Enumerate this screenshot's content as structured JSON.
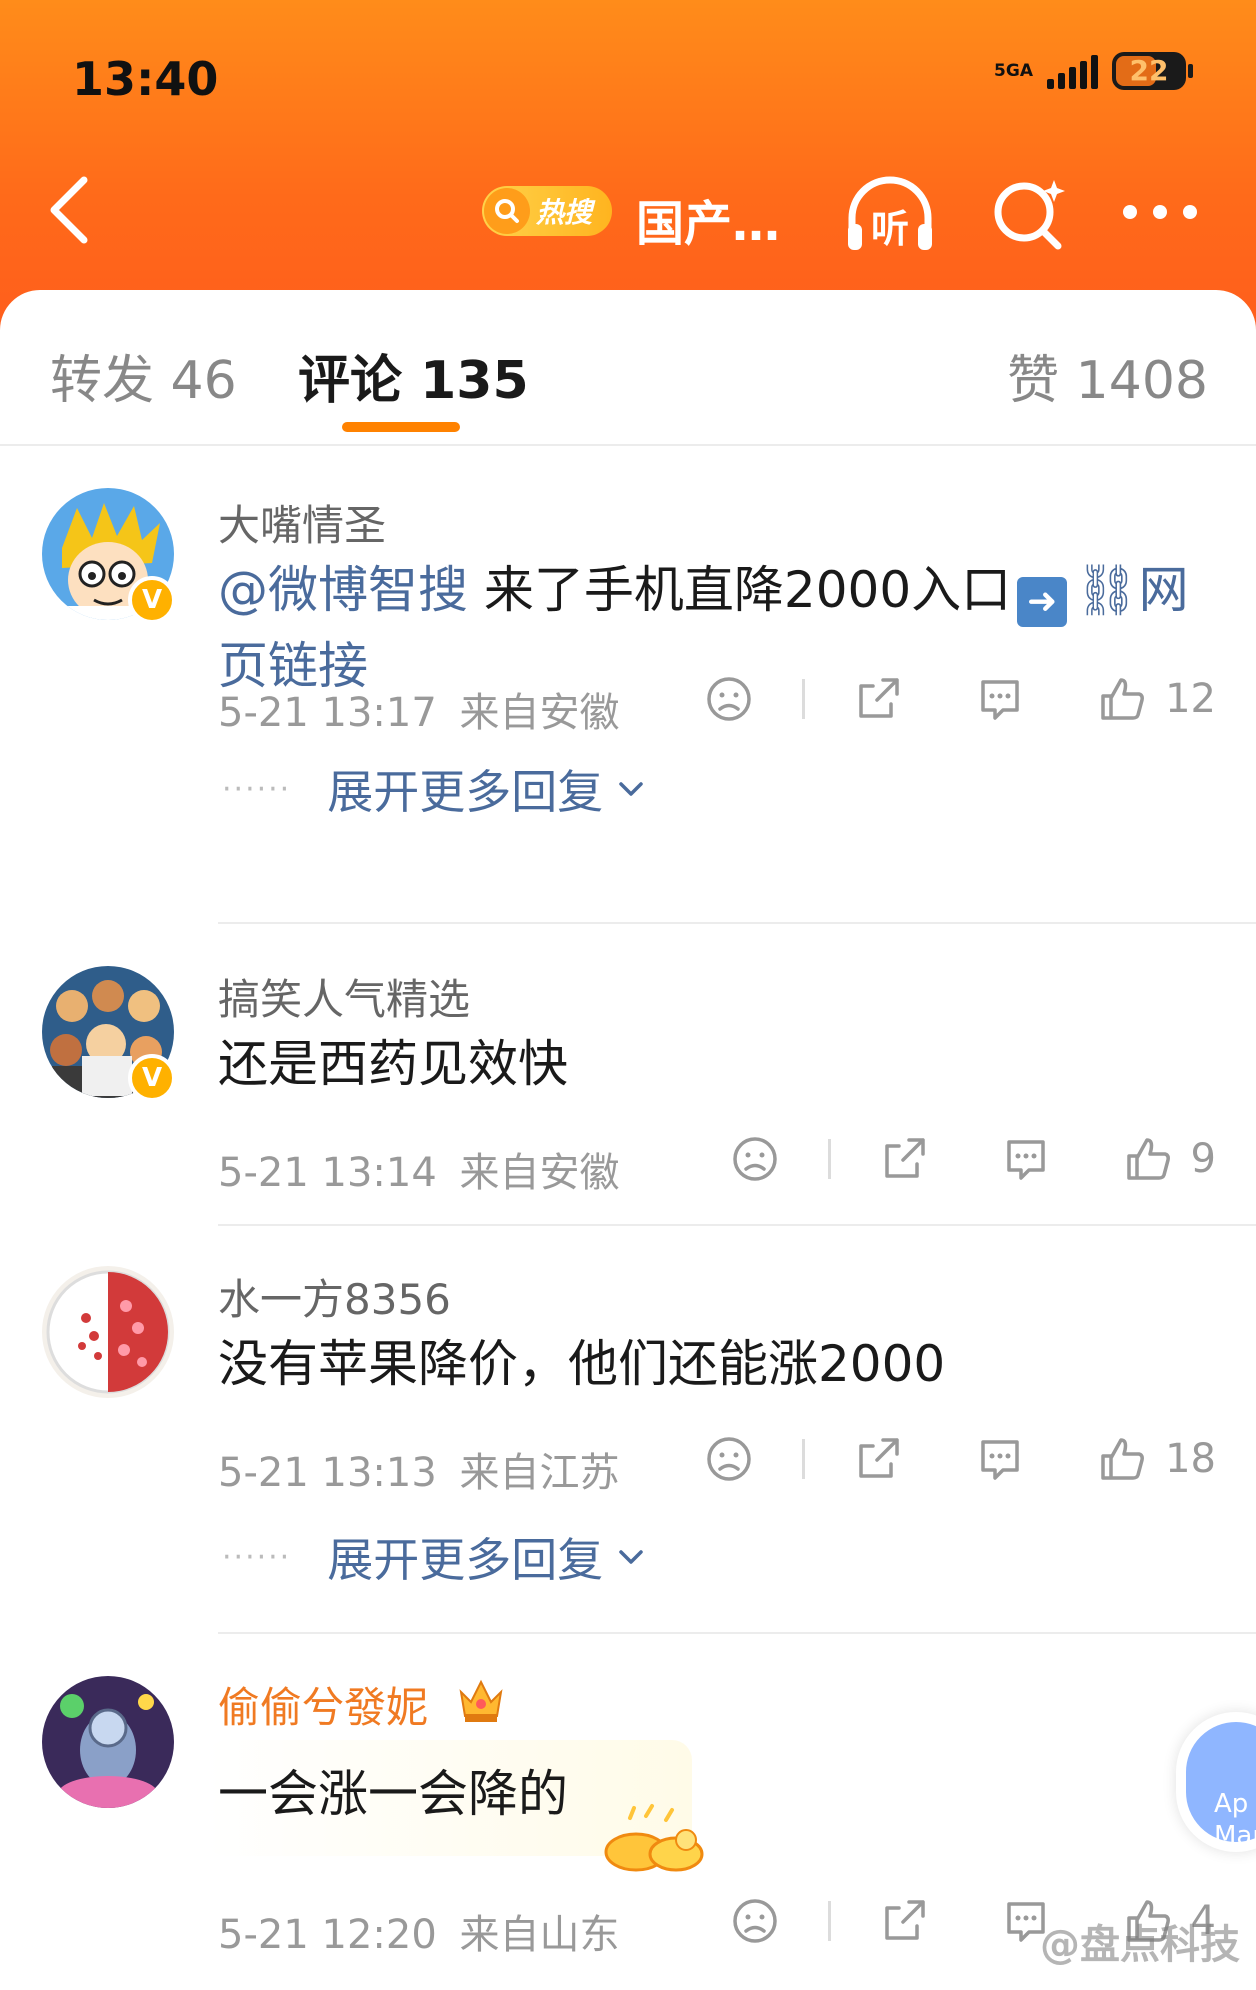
{
  "status": {
    "time": "13:40",
    "network": "5GA",
    "battery": "22"
  },
  "nav": {
    "hot_label": "热搜",
    "topic_title": "国产…",
    "listen_label": "听"
  },
  "tabs": [
    {
      "label": "转发 46"
    },
    {
      "label": "评论 135"
    },
    {
      "label": "赞 1408"
    }
  ],
  "comments": [
    {
      "user": "大嘴情圣",
      "verified": true,
      "mention": "@微博智搜",
      "text": " 来了手机直降2000入口",
      "link_text": "网页链接",
      "time": "5-21 13:17",
      "location": "来自安徽",
      "likes": "12",
      "expand": "展开更多回复"
    },
    {
      "user": "搞笑人气精选",
      "verified": true,
      "text": "还是西药见效快",
      "time": "5-21 13:14",
      "location": "来自安徽",
      "likes": "9"
    },
    {
      "user": "水一方8356",
      "verified": false,
      "text": "没有苹果降价，他们还能涨2000",
      "time": "5-21 13:13",
      "location": "来自江苏",
      "likes": "18",
      "expand": "展开更多回复"
    },
    {
      "user": "偷偷兮發妮",
      "verified": false,
      "vip": true,
      "text": "一会涨一会降的",
      "time": "5-21 12:20",
      "location": "来自山东",
      "likes": "4"
    }
  ],
  "float_button": {
    "line1": "Ap",
    "line2": "Mar"
  },
  "watermark": "@盘点科技",
  "colors": {
    "header": "#ff7a1a",
    "tab_accent": "#ff8200",
    "link": "#4a6b9c",
    "vip_name": "#f07a22"
  }
}
